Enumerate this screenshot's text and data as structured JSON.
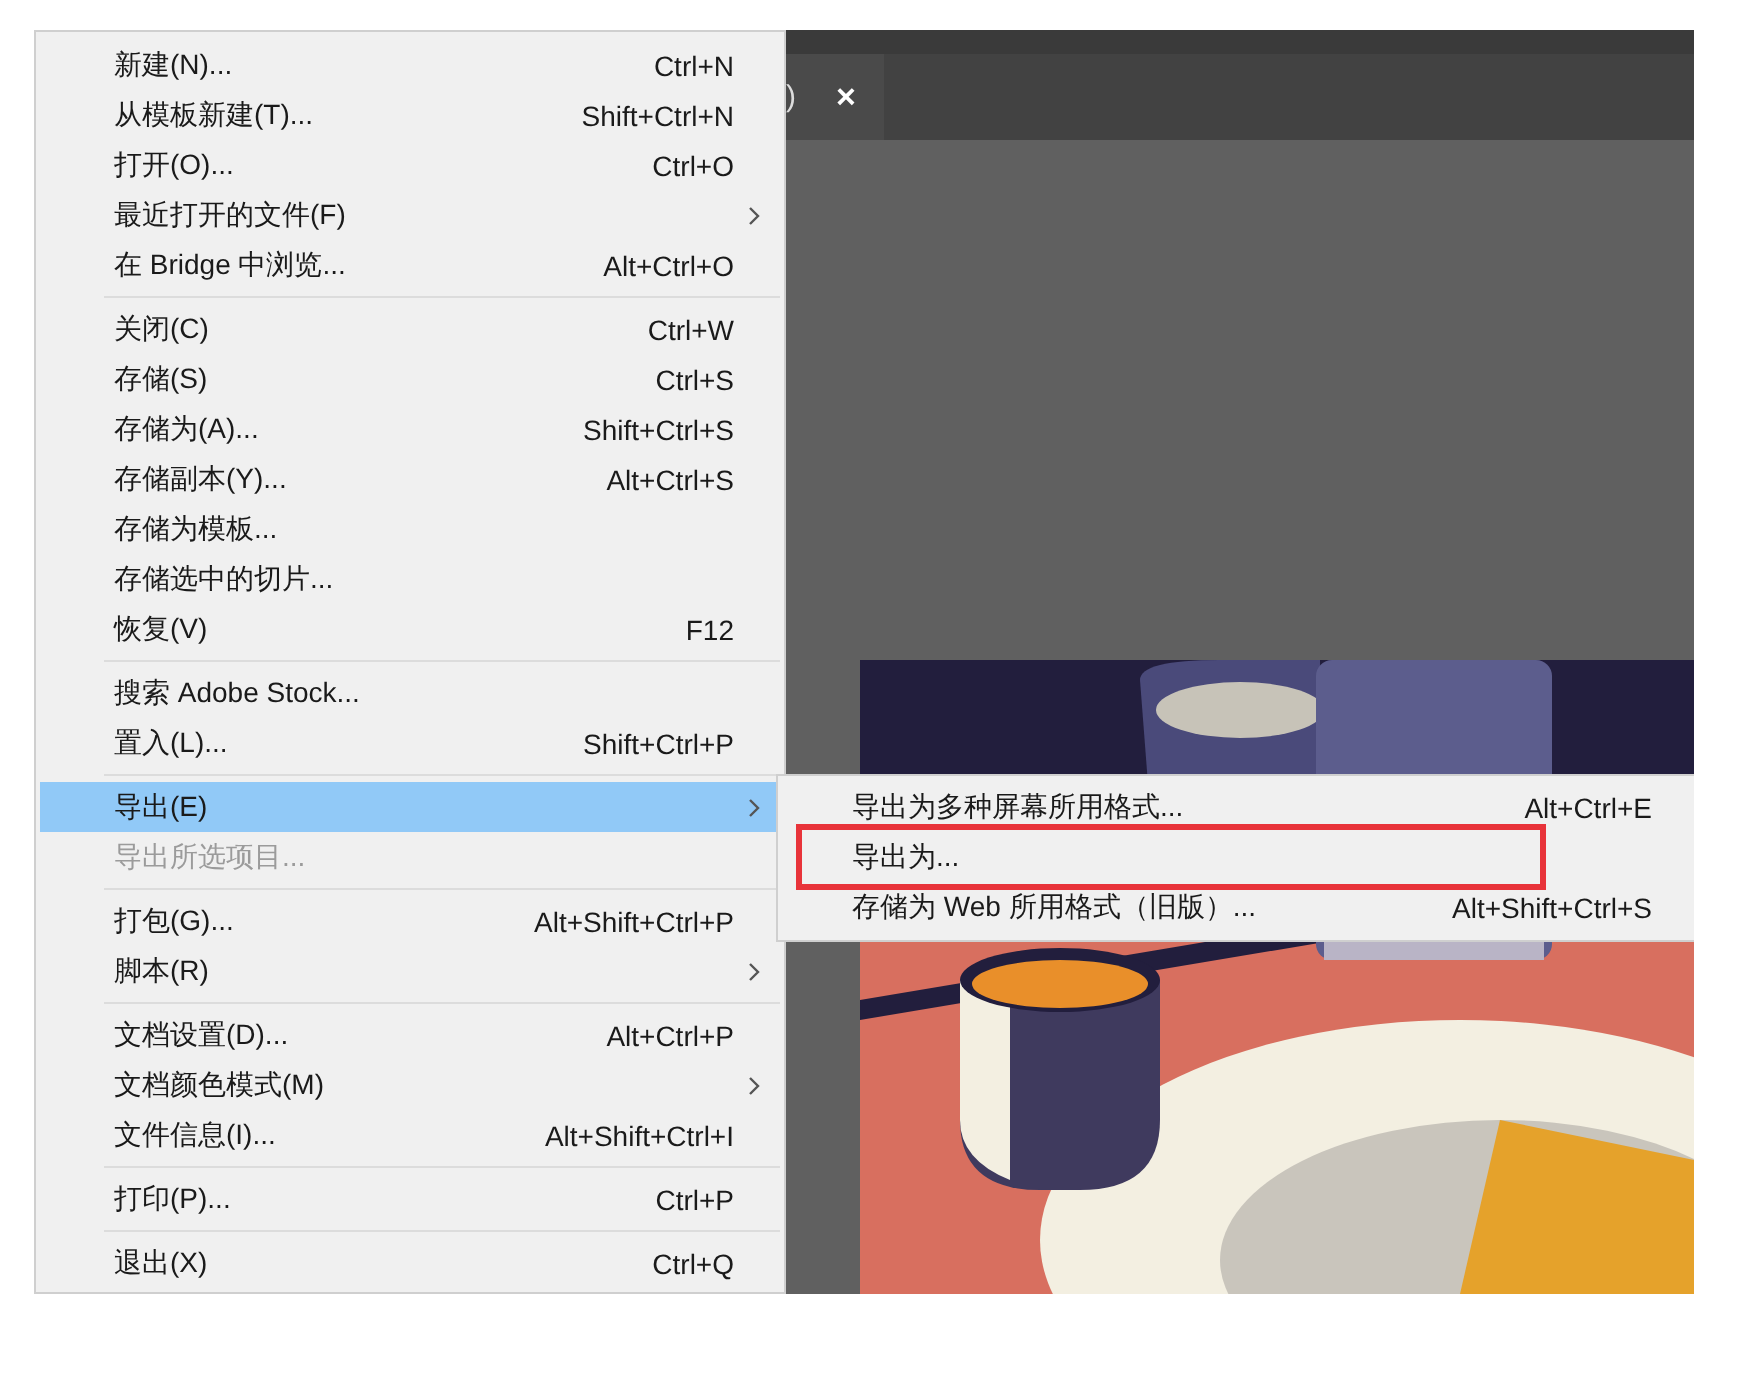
{
  "document_tab": {
    "label": ")",
    "close": "×"
  },
  "menu": {
    "groups": [
      [
        {
          "label": "新建(N)...",
          "shortcut": "Ctrl+N",
          "submenu": false,
          "selected": false,
          "disabled": false
        },
        {
          "label": "从模板新建(T)...",
          "shortcut": "Shift+Ctrl+N",
          "submenu": false,
          "selected": false,
          "disabled": false
        },
        {
          "label": "打开(O)...",
          "shortcut": "Ctrl+O",
          "submenu": false,
          "selected": false,
          "disabled": false
        },
        {
          "label": "最近打开的文件(F)",
          "submenu": true,
          "selected": false,
          "disabled": false
        },
        {
          "label": "在 Bridge 中浏览...",
          "shortcut": "Alt+Ctrl+O",
          "submenu": false,
          "selected": false,
          "disabled": false
        }
      ],
      [
        {
          "label": "关闭(C)",
          "shortcut": "Ctrl+W",
          "submenu": false,
          "selected": false,
          "disabled": false
        },
        {
          "label": "存储(S)",
          "shortcut": "Ctrl+S",
          "submenu": false,
          "selected": false,
          "disabled": false
        },
        {
          "label": "存储为(A)...",
          "shortcut": "Shift+Ctrl+S",
          "submenu": false,
          "selected": false,
          "disabled": false
        },
        {
          "label": "存储副本(Y)...",
          "shortcut": "Alt+Ctrl+S",
          "submenu": false,
          "selected": false,
          "disabled": false
        },
        {
          "label": "存储为模板...",
          "submenu": false,
          "selected": false,
          "disabled": false
        },
        {
          "label": "存储选中的切片...",
          "submenu": false,
          "selected": false,
          "disabled": false
        },
        {
          "label": "恢复(V)",
          "shortcut": "F12",
          "submenu": false,
          "selected": false,
          "disabled": false
        }
      ],
      [
        {
          "label": "搜索 Adobe Stock...",
          "submenu": false,
          "selected": false,
          "disabled": false
        },
        {
          "label": "置入(L)...",
          "shortcut": "Shift+Ctrl+P",
          "submenu": false,
          "selected": false,
          "disabled": false
        }
      ],
      [
        {
          "label": "导出(E)",
          "submenu": true,
          "selected": true,
          "disabled": false
        },
        {
          "label": "导出所选项目...",
          "submenu": false,
          "selected": false,
          "disabled": true
        }
      ],
      [
        {
          "label": "打包(G)...",
          "shortcut": "Alt+Shift+Ctrl+P",
          "submenu": false,
          "selected": false,
          "disabled": false
        },
        {
          "label": "脚本(R)",
          "submenu": true,
          "selected": false,
          "disabled": false
        }
      ],
      [
        {
          "label": "文档设置(D)...",
          "shortcut": "Alt+Ctrl+P",
          "submenu": false,
          "selected": false,
          "disabled": false
        },
        {
          "label": "文档颜色模式(M)",
          "submenu": true,
          "selected": false,
          "disabled": false
        },
        {
          "label": "文件信息(I)...",
          "shortcut": "Alt+Shift+Ctrl+I",
          "submenu": false,
          "selected": false,
          "disabled": false
        }
      ],
      [
        {
          "label": "打印(P)...",
          "shortcut": "Ctrl+P",
          "submenu": false,
          "selected": false,
          "disabled": false
        }
      ],
      [
        {
          "label": "退出(X)",
          "shortcut": "Ctrl+Q",
          "submenu": false,
          "selected": false,
          "disabled": false
        }
      ]
    ]
  },
  "submenu": {
    "items": [
      {
        "label": "导出为多种屏幕所用格式...",
        "shortcut": "Alt+Ctrl+E",
        "highlighted": false
      },
      {
        "label": "导出为...",
        "highlighted": true
      },
      {
        "label": "存储为 Web 所用格式（旧版）...",
        "shortcut": "Alt+Shift+Ctrl+S",
        "highlighted": false
      }
    ]
  }
}
